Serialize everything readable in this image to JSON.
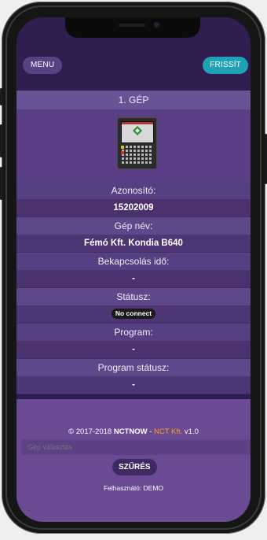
{
  "header": {
    "menu_label": "MENU",
    "refresh_label": "FRISSÍT"
  },
  "machine": {
    "title": "1. GÉP",
    "fields": [
      {
        "label": "Azonosító:",
        "value": "15202009"
      },
      {
        "label": "Gép név:",
        "value": "Fémó Kft. Kondia B640"
      },
      {
        "label": "Bekapcsolás idő:",
        "value": "-"
      },
      {
        "label": "Státusz:",
        "value": "No connect"
      },
      {
        "label": "Program:",
        "value": "-"
      },
      {
        "label": "Program státusz:",
        "value": "-"
      }
    ]
  },
  "footer": {
    "copyright_prefix": "© 2017-2018",
    "copyright_brand": "NCTNOW",
    "copyright_sep": " - ",
    "company": "NCT Kft.",
    "version": "v1.0",
    "select_placeholder": "Gép választás",
    "filter_label": "SZŰRÉS",
    "user_line": "Felhasználó: DEMO"
  },
  "colors": {
    "accent_refresh": "#1fa3b4",
    "brand_orange": "#f5a523",
    "panel_purple": "#574081"
  }
}
